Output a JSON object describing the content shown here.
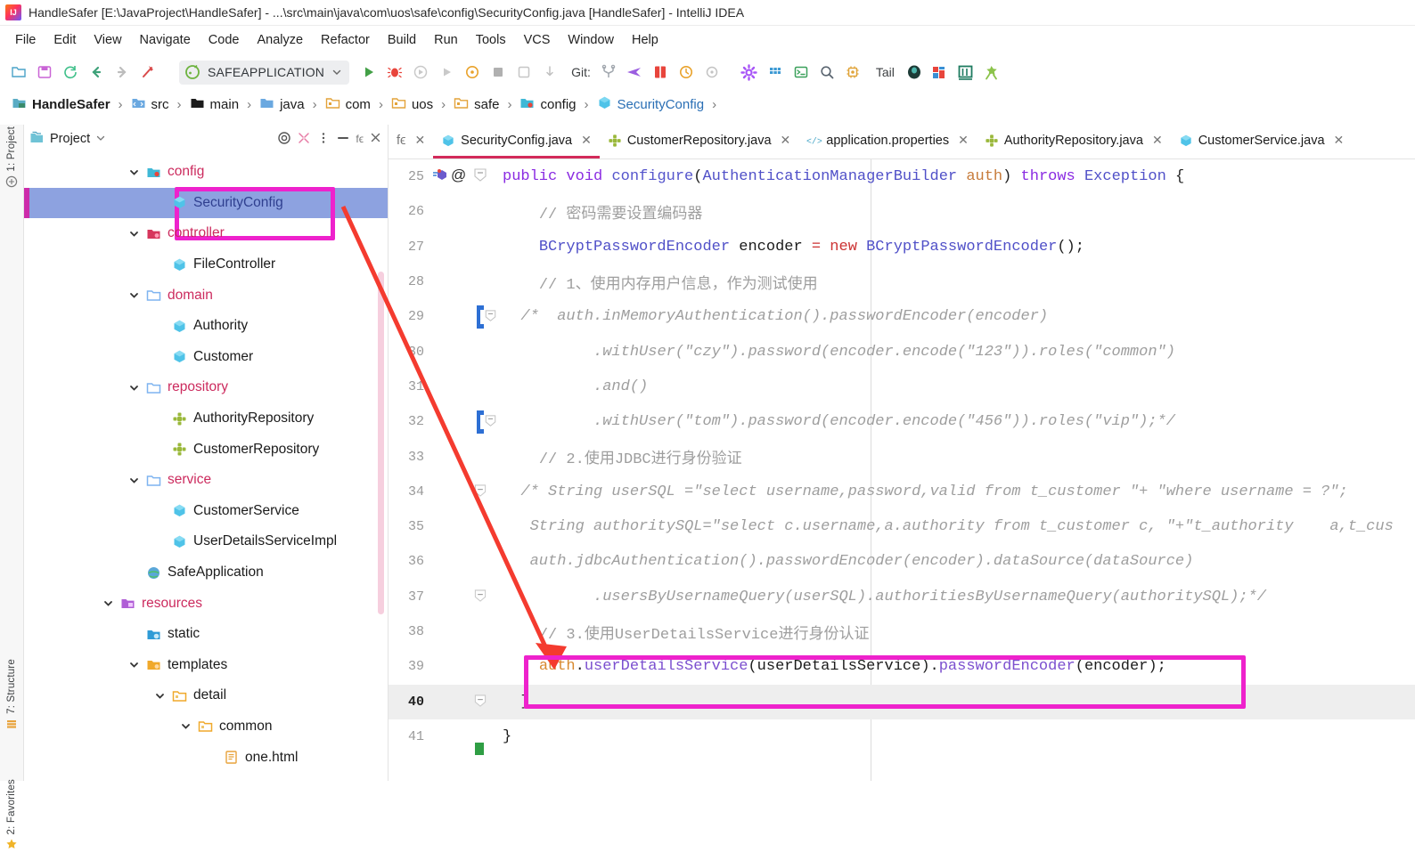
{
  "window": {
    "title": "HandleSafer [E:\\JavaProject\\HandleSafer] - ...\\src\\main\\java\\com\\uos\\safe\\config\\SecurityConfig.java [HandleSafer] - IntelliJ IDEA",
    "app_icon": "intellij-idea-icon"
  },
  "menubar": {
    "items": [
      {
        "label": "File"
      },
      {
        "label": "Edit"
      },
      {
        "label": "View"
      },
      {
        "label": "Navigate"
      },
      {
        "label": "Code"
      },
      {
        "label": "Analyze"
      },
      {
        "label": "Refactor"
      },
      {
        "label": "Build"
      },
      {
        "label": "Run"
      },
      {
        "label": "Tools"
      },
      {
        "label": "VCS"
      },
      {
        "label": "Window"
      },
      {
        "label": "Help"
      }
    ]
  },
  "toolbar": {
    "run_config": "SAFEAPPLICATION",
    "git_label": "Git:",
    "tail_label": "Tail",
    "icons": [
      "open-folder-icon",
      "save-all-icon",
      "sync-refresh-icon",
      "back-arrow-icon",
      "forward-arrow-icon",
      "build-hammer-icon",
      "run-config-icon",
      "chevron-down-icon",
      "run-icon",
      "debug-icon",
      "run-with-coverage-icon",
      "run-gray-icon",
      "profiler-icon",
      "stop-icon",
      "attach-icon",
      "update-icon",
      "git-branch-icon",
      "git-push-icon",
      "git-diff-icon",
      "git-history-icon",
      "git-revert-icon",
      "settings-gear-icon",
      "grid-icon",
      "terminal-icon",
      "search-icon",
      "build-chip-icon",
      "tail-icon",
      "database-icon",
      "maven-icon",
      "struct-icon",
      "plugin-icon"
    ]
  },
  "breadcrumb": {
    "items": [
      {
        "label": "HandleSafer",
        "icon": "module-icon"
      },
      {
        "label": "src",
        "icon": "src-folder-icon"
      },
      {
        "label": "main",
        "icon": "folder-black-icon"
      },
      {
        "label": "java",
        "icon": "java-folder-icon"
      },
      {
        "label": "com",
        "icon": "package-icon"
      },
      {
        "label": "uos",
        "icon": "package-icon"
      },
      {
        "label": "safe",
        "icon": "package-icon"
      },
      {
        "label": "config",
        "icon": "config-folder-icon"
      },
      {
        "label": "SecurityConfig",
        "icon": "java-class-icon"
      }
    ]
  },
  "left_strip": {
    "tabs": [
      {
        "label": "1: Project",
        "icon": "project-icon"
      },
      {
        "label": "7: Structure",
        "icon": "structure-icon"
      },
      {
        "label": "2: Favorites",
        "icon": "star-icon"
      }
    ]
  },
  "project_panel": {
    "title": "Project",
    "actions": [
      "target-locate-icon",
      "collapse-all-icon",
      "more-options-icon",
      "hide-icon",
      "fe-icon",
      "close-icon"
    ],
    "tree": [
      {
        "label": "config",
        "indent": 3,
        "kind": "folder-pink",
        "icon": "config-folder-icon",
        "expanded": true,
        "selected": false
      },
      {
        "label": "SecurityConfig",
        "indent": 4,
        "kind": "class",
        "icon": "java-class-icon",
        "expanded": null,
        "selected": true
      },
      {
        "label": "controller",
        "indent": 3,
        "kind": "folder-pink",
        "icon": "controller-folder-icon",
        "expanded": true,
        "selected": false
      },
      {
        "label": "FileController",
        "indent": 4,
        "kind": "class",
        "icon": "java-class-icon",
        "expanded": null,
        "selected": false
      },
      {
        "label": "domain",
        "indent": 3,
        "kind": "folder-pink",
        "icon": "folder-icon",
        "expanded": true,
        "selected": false
      },
      {
        "label": "Authority",
        "indent": 4,
        "kind": "class",
        "icon": "java-class-icon",
        "expanded": null,
        "selected": false
      },
      {
        "label": "Customer",
        "indent": 4,
        "kind": "class",
        "icon": "java-class-icon",
        "expanded": null,
        "selected": false
      },
      {
        "label": "repository",
        "indent": 3,
        "kind": "folder-pink",
        "icon": "folder-icon",
        "expanded": true,
        "selected": false
      },
      {
        "label": "AuthorityRepository",
        "indent": 4,
        "kind": "interface",
        "icon": "java-interface-icon",
        "expanded": null,
        "selected": false
      },
      {
        "label": "CustomerRepository",
        "indent": 4,
        "kind": "interface",
        "icon": "java-interface-icon",
        "expanded": null,
        "selected": false
      },
      {
        "label": "service",
        "indent": 3,
        "kind": "folder-pink",
        "icon": "folder-icon",
        "expanded": true,
        "selected": false
      },
      {
        "label": "CustomerService",
        "indent": 4,
        "kind": "class",
        "icon": "java-class-icon",
        "expanded": null,
        "selected": false
      },
      {
        "label": "UserDetailsServiceImpl",
        "indent": 4,
        "kind": "class",
        "icon": "java-class-icon",
        "expanded": null,
        "selected": false
      },
      {
        "label": "SafeApplication",
        "indent": 3,
        "kind": "springboot",
        "icon": "spring-boot-icon",
        "expanded": null,
        "selected": false
      },
      {
        "label": "resources",
        "indent": 2,
        "kind": "folder-pink",
        "icon": "resources-folder-icon",
        "expanded": true,
        "selected": false
      },
      {
        "label": "static",
        "indent": 3,
        "kind": "plain",
        "icon": "static-folder-icon",
        "expanded": null,
        "selected": false
      },
      {
        "label": "templates",
        "indent": 3,
        "kind": "plain",
        "icon": "templates-folder-icon",
        "expanded": true,
        "selected": false
      },
      {
        "label": "detail",
        "indent": 4,
        "kind": "plain",
        "icon": "folder-yellow-icon",
        "expanded": true,
        "selected": false
      },
      {
        "label": "common",
        "indent": 5,
        "kind": "plain",
        "icon": "folder-yellow-icon",
        "expanded": true,
        "selected": false
      },
      {
        "label": "one.html",
        "indent": 6,
        "kind": "plain",
        "icon": "html-file-icon",
        "expanded": null,
        "selected": false
      }
    ]
  },
  "editor": {
    "tabs": [
      {
        "label": "SecurityConfig.java",
        "icon": "java-class-icon",
        "active": true
      },
      {
        "label": "CustomerRepository.java",
        "icon": "java-interface-icon",
        "active": false
      },
      {
        "label": "application.properties",
        "icon": "properties-icon",
        "active": false
      },
      {
        "label": "AuthorityRepository.java",
        "icon": "java-interface-icon",
        "active": false
      },
      {
        "label": "CustomerService.java",
        "icon": "java-class-icon",
        "active": false
      }
    ],
    "first_line_number": 25,
    "current_line": 40,
    "lines": [
      {
        "n": 25,
        "html": "<span class=\"kw\">public</span> <span class=\"kw\">void</span> <span class=\"fn\">configure</span>(<span class=\"typ\">AuthenticationManagerBuilder</span> <span class=\"par\">auth</span>) <span class=\"kw\">throws</span> <span class=\"typ\">Exception</span> {",
        "text": "public void configure(AuthenticationManagerBuilder auth) throws Exception {"
      },
      {
        "n": 26,
        "html": "    <span class=\"cmt\">// 密码需要设置编码器</span>",
        "text": "// 密码需要设置编码器"
      },
      {
        "n": 27,
        "html": "    <span class=\"typ\">BCryptPasswordEncoder</span> <span class=\"id\">encoder</span> <span class=\"kw2\">=</span> <span class=\"kw2\">new</span> <span class=\"typ\">BCryptPasswordEncoder</span>();",
        "text": "BCryptPasswordEncoder encoder = new BCryptPasswordEncoder();"
      },
      {
        "n": 28,
        "html": "    <span class=\"cmt\">// 1、使用内存用户信息，作为测试使用</span>",
        "text": "// 1、使用内存用户信息，作为测试使用"
      },
      {
        "n": 29,
        "html": "  <span class=\"cmt-i\">/*  auth.inMemoryAuthentication().passwordEncoder(encoder)</span>",
        "text": "/*  auth.inMemoryAuthentication().passwordEncoder(encoder)"
      },
      {
        "n": 30,
        "html": "          <span class=\"cmt-i\">.withUser(\"czy\").password(encoder.encode(\"123\")).roles(\"common\")</span>",
        "text": ".withUser(\"czy\").password(encoder.encode(\"123\")).roles(\"common\")"
      },
      {
        "n": 31,
        "html": "          <span class=\"cmt-i\">.and()</span>",
        "text": ".and()"
      },
      {
        "n": 32,
        "html": "          <span class=\"cmt-i\">.withUser(\"tom\").password(encoder.encode(\"456\")).roles(\"vip\");*/</span>",
        "text": ".withUser(\"tom\").password(encoder.encode(\"456\")).roles(\"vip\");*/"
      },
      {
        "n": 33,
        "html": "    <span class=\"cmt\">// 2.使用JDBC进行身份验证</span>",
        "text": "// 2.使用JDBC进行身份验证"
      },
      {
        "n": 34,
        "html": "  <span class=\"cmt-i\">/* String userSQL =\"select username,password,valid from t_customer \"+ \"where username = ?\";</span>",
        "text": "/* String userSQL =\"select username,password,valid from t_customer \"+ \"where username = ?\";"
      },
      {
        "n": 35,
        "html": "   <span class=\"cmt-i\">String authoritySQL=\"select c.username,a.authority from t_customer c, \"+\"t_authority    a,t_cus</span>",
        "text": "String authoritySQL=\"select c.username,a.authority from t_customer c, \"+\"t_authority    a,t_cus"
      },
      {
        "n": 36,
        "html": "   <span class=\"cmt-i\">auth.jdbcAuthentication().passwordEncoder(encoder).dataSource(dataSource)</span>",
        "text": "auth.jdbcAuthentication().passwordEncoder(encoder).dataSource(dataSource)"
      },
      {
        "n": 37,
        "html": "          <span class=\"cmt-i\">.usersByUsernameQuery(userSQL).authoritiesByUsernameQuery(authoritySQL);*/</span>",
        "text": ".usersByUsernameQuery(userSQL).authoritiesByUsernameQuery(authoritySQL);*/"
      },
      {
        "n": 38,
        "html": "    <span class=\"cmt\">// 3.使用UserDetailsService进行身份认证</span>",
        "text": "// 3.使用UserDetailsService进行身份认证"
      },
      {
        "n": 39,
        "html": "    <span class=\"orange\">auth</span>.<span class=\"purple\">userDetailsService</span>(<span class=\"id\">userDetailsService</span>).<span class=\"purple\">passwordEncoder</span>(<span class=\"id\">encoder</span>);",
        "text": "auth.userDetailsService(userDetailsService).passwordEncoder(encoder);"
      },
      {
        "n": 40,
        "html": "  <span class=\"id\">}</span>",
        "text": "}"
      },
      {
        "n": 41,
        "html": "<span class=\"id\">}</span>",
        "text": "}"
      }
    ]
  },
  "annotations": {
    "highlight_color": "#ee22cc",
    "arrow_color": "#f43b2f",
    "tree_box_target": "SecurityConfig",
    "code_box_target": "auth.userDetailsService(userDetailsService).passwordEncoder(encoder);"
  }
}
